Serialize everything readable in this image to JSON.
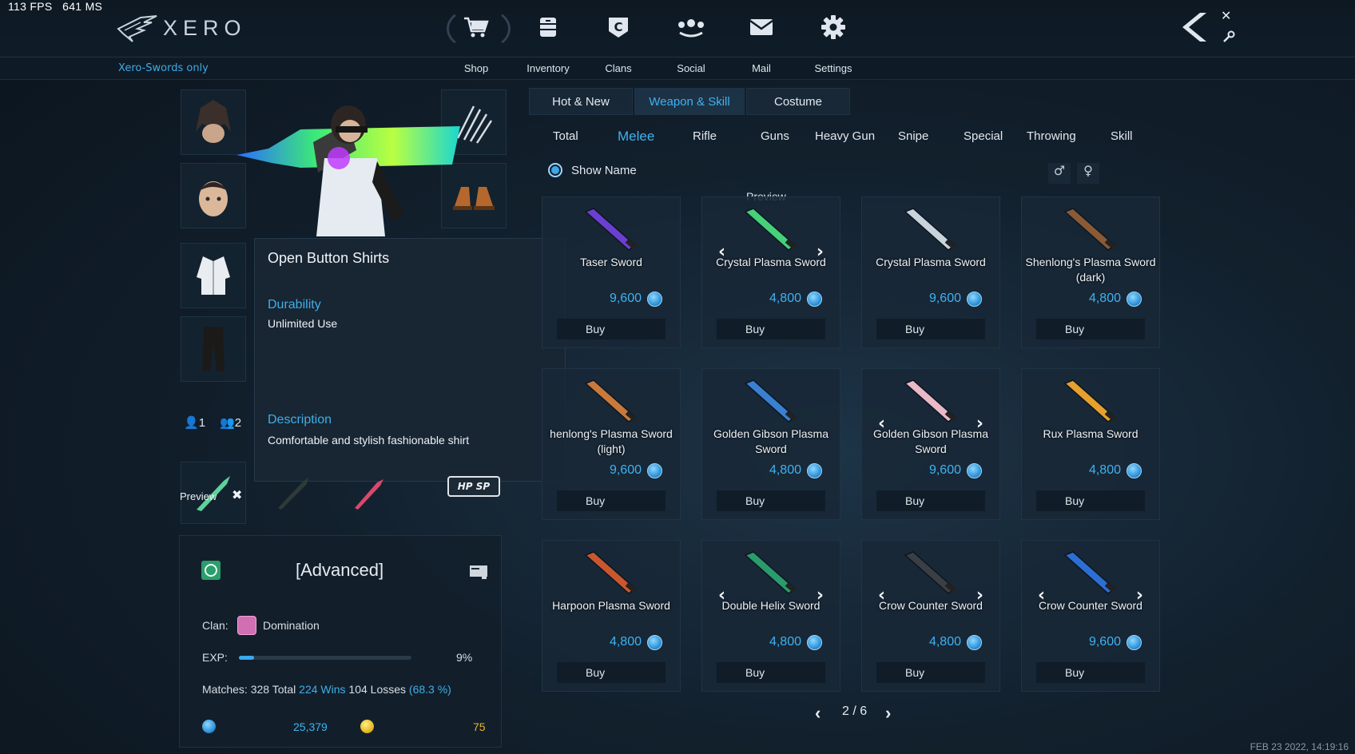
{
  "perf": {
    "fps": "113 FPS",
    "ms": "641 MS"
  },
  "app": {
    "name": "XERO",
    "filter_label": "Xero-Swords only"
  },
  "nav": [
    {
      "label": "Shop",
      "icon": "cart-icon"
    },
    {
      "label": "Inventory",
      "icon": "inventory-icon"
    },
    {
      "label": "Clans",
      "icon": "clan-icon"
    },
    {
      "label": "Social",
      "icon": "social-icon"
    },
    {
      "label": "Mail",
      "icon": "mail-icon"
    },
    {
      "label": "Settings",
      "icon": "gear-icon"
    }
  ],
  "character": {
    "preset_1": "1",
    "preset_2": "2",
    "preview_label": "Preview",
    "hp_sp_label": "HP SP"
  },
  "tooltip": {
    "title": "Open Button Shirts",
    "durability_label": "Durability",
    "durability_value": "Unlimited Use",
    "description_label": "Description",
    "description_value": "Comfortable and stylish fashionable shirt"
  },
  "stats": {
    "rank": "[Advanced]",
    "clan_label": "Clan:",
    "clan_name": "Domination",
    "exp_label": "EXP:",
    "exp_percent": "9%",
    "exp_fraction": 0.09,
    "matches_label": "Matches:",
    "matches_total": "328 Total",
    "wins": "224 Wins",
    "losses": "104 Losses",
    "winrate": "(68.3 %)",
    "blue_currency": "25,379",
    "gold_currency": "75"
  },
  "shop": {
    "top_tabs": [
      "Hot & New",
      "Weapon & Skill",
      "Costume"
    ],
    "active_top_tab": "Weapon & Skill",
    "sub_tabs": [
      "Total",
      "Melee",
      "Rifle",
      "Guns",
      "Heavy Gun",
      "Snipe",
      "Special",
      "Throwing",
      "Skill"
    ],
    "active_sub_tab": "Melee",
    "show_name_label": "Show Name",
    "show_name_checked": true,
    "male_symbol": "♂",
    "female_symbol": "♀",
    "preview_label": "Preview",
    "buy_label": "Buy",
    "items": [
      {
        "name": "Taser Sword",
        "price": "9,600",
        "arrows": false,
        "color": "#6b3fd0"
      },
      {
        "name": "Crystal Plasma Sword",
        "price": "4,800",
        "arrows": true,
        "color": "#46d07a"
      },
      {
        "name": "Crystal Plasma Sword",
        "price": "9,600",
        "arrows": false,
        "color": "#c9d3dc"
      },
      {
        "name": "Shenlong's Plasma Sword (dark)",
        "price": "4,800",
        "arrows": false,
        "color": "#8a5a36"
      },
      {
        "name": "henlong's Plasma Sword (light)",
        "price": "9,600",
        "arrows": false,
        "color": "#c8793b"
      },
      {
        "name": "Golden Gibson Plasma Sword",
        "price": "4,800",
        "arrows": false,
        "color": "#3a7fd1"
      },
      {
        "name": "Golden Gibson Plasma Sword",
        "price": "9,600",
        "arrows": true,
        "color": "#e9b9c8"
      },
      {
        "name": "Rux Plasma Sword",
        "price": "4,800",
        "arrows": false,
        "color": "#e6a02c"
      },
      {
        "name": "Harpoon Plasma Sword",
        "price": "4,800",
        "arrows": false,
        "color": "#c9572e"
      },
      {
        "name": "Double Helix Sword",
        "price": "4,800",
        "arrows": true,
        "color": "#2a9b6c"
      },
      {
        "name": "Crow Counter Sword",
        "price": "4,800",
        "arrows": true,
        "color": "#3a3f46"
      },
      {
        "name": "Crow Counter Sword",
        "price": "9,600",
        "arrows": true,
        "color": "#2c6fd4"
      }
    ],
    "page": "2 / 6"
  },
  "timestamp": "FEB 23 2022, 14:19:16"
}
